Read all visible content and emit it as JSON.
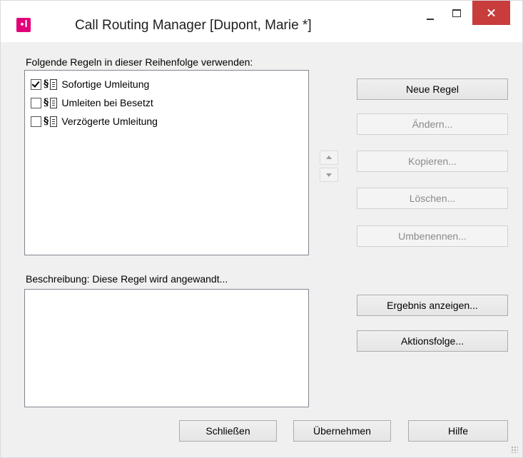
{
  "window": {
    "title": "Call Routing Manager [Dupont, Marie *]",
    "icon": "app-logo-icon",
    "controls": [
      "minimize-icon",
      "maximize-icon",
      "close-icon"
    ]
  },
  "rules_section": {
    "label": "Folgende Regeln in dieser Reihenfolge verwenden:",
    "items": [
      {
        "label": "Sofortige Umleitung",
        "checked": true
      },
      {
        "label": "Umleiten bei Besetzt",
        "checked": false
      },
      {
        "label": "Verzögerte Umleitung",
        "checked": false
      }
    ]
  },
  "rule_buttons": {
    "new": "Neue Regel",
    "edit": "Ändern...",
    "copy": "Kopieren...",
    "delete": "Löschen...",
    "rename": "Umbenennen..."
  },
  "description_section": {
    "label": "Beschreibung: Diese Regel wird angewandt...",
    "text": ""
  },
  "action_buttons": {
    "show_result": "Ergebnis anzeigen...",
    "action_sequence": "Aktionsfolge..."
  },
  "footer_buttons": {
    "close": "Schließen",
    "apply": "Übernehmen",
    "help": "Hilfe"
  },
  "colors": {
    "brand": "#e2007a",
    "close_button": "#c83c3c",
    "dialog_bg": "#f0f0f0"
  }
}
